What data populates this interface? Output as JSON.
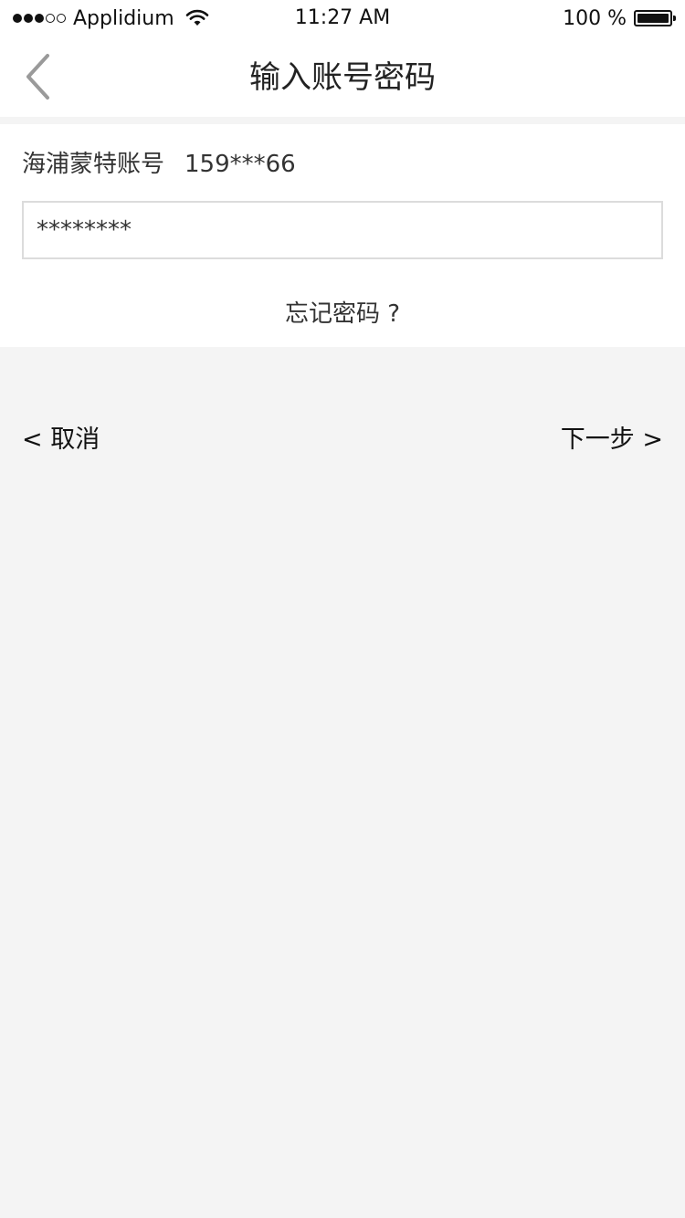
{
  "status_bar": {
    "carrier": "Applidium",
    "time": "11:27 AM",
    "battery_percent": "100 %",
    "signal_bars_filled": 3,
    "signal_bars_total": 5,
    "battery_level": 1.0
  },
  "nav": {
    "title": "输入账号密码",
    "back_icon": "chevron-left-icon"
  },
  "form": {
    "account_label": "海浦蒙特账号",
    "account_value": "159***66",
    "password_value": "********",
    "forgot_link": "忘记密码 ?"
  },
  "actions": {
    "cancel_label": "< 取消",
    "next_label": "下一步 >"
  },
  "colors": {
    "page_background": "#f4f4f4",
    "card_background": "#ffffff",
    "input_border": "#dcdcdc",
    "text": "#222222",
    "back_icon": "#9a9a9a"
  }
}
